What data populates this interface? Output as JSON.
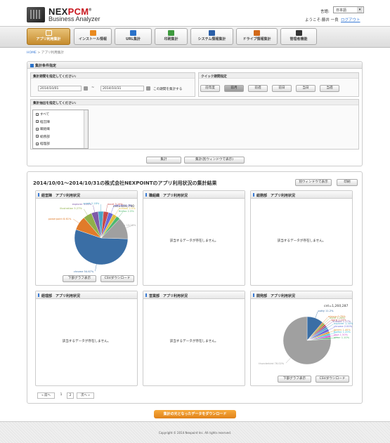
{
  "header": {
    "brand_a": "NEX",
    "brand_b": "PCM",
    "brand_reg": "®",
    "brand_sub": "Business Analyzer",
    "lang_label": "言語:",
    "lang_value": "日本語",
    "welcome": "ようこそ:藤井 一良",
    "logout": "ログアウト"
  },
  "nav": [
    {
      "label": "アプリ利用集計",
      "icon": "app-usage-icon",
      "color": "#ffffff",
      "active": true
    },
    {
      "label": "インストール情報",
      "icon": "install-list-icon",
      "color": "#e98a1f",
      "active": false
    },
    {
      "label": "URL集計",
      "icon": "url-link-icon",
      "color": "#2a72c9",
      "active": false
    },
    {
      "label": "印刷集計",
      "icon": "print-icon",
      "color": "#3e9a3e",
      "active": false
    },
    {
      "label": "システム情報集計",
      "icon": "system-edit-icon",
      "color": "#2a5fa8",
      "active": false
    },
    {
      "label": "ドライブ情報集計",
      "icon": "rss-drive-icon",
      "color": "#d26a1a",
      "active": false
    },
    {
      "label": "管理者機能",
      "icon": "gear-icon",
      "color": "#333333",
      "active": false
    }
  ],
  "breadcrumb": {
    "home": "HOME",
    "sep": ">",
    "current": "アプリ利用集計"
  },
  "conditions": {
    "title": "集計条件指定",
    "period_label": "集計期間を指定してください:",
    "date_from": "2014/10/01",
    "tilde": "~",
    "date_to": "2014/10/31",
    "period_note": "この期間を集計する",
    "quick_label": "クイック期間指定",
    "quick": [
      "前年度",
      "前月",
      "前週",
      "前日",
      "当日",
      "当週"
    ],
    "quick_selected": "前月",
    "target_label": "集計抽出を指定してください:",
    "targets": [
      {
        "label": "すべて",
        "checked": true
      },
      {
        "label": "経営陣",
        "checked": true
      },
      {
        "label": "職組織",
        "checked": true
      },
      {
        "label": "総務部",
        "checked": true
      },
      {
        "label": "経理部",
        "checked": true
      }
    ],
    "btn_run": "集計",
    "btn_run_new": "集計(別ウィンドウで表示)"
  },
  "results": {
    "title": "2014/10/01～2014/10/31の株式会社NEXPOINTのアプリ利用状況の集計結果",
    "btn_new_window": "別ウィンドウで表示",
    "btn_print": "印刷",
    "empty_msg": "該当するデータが存在しません。",
    "btn_sub_graph": "下部グラフ表示",
    "btn_csv": "CSVダウンロード",
    "cards": [
      {
        "title": "経営陣　アプリ利用状況",
        "total": "cnt=109,790",
        "has_data": true
      },
      {
        "title": "職組織　アプリ利用状況",
        "has_data": false
      },
      {
        "title": "総務部　アプリ利用状況",
        "has_data": false
      },
      {
        "title": "経理部　アプリ利用状況",
        "has_data": false
      },
      {
        "title": "営業部　アプリ利用状況",
        "has_data": false
      },
      {
        "title": "開発部　アプリ利用状況",
        "total": "cnt=1,260,287",
        "has_data": true
      }
    ],
    "pager": {
      "prev": "« 前へ",
      "p1": "1",
      "p2": "2",
      "next": "次へ »"
    }
  },
  "pie1": {
    "colors": [
      "#3a6ea5",
      "#e07b2a",
      "#8fb04a",
      "#7e5aa8",
      "#4aa6c8",
      "#c84a4a",
      "#6a6ad8",
      "#e0c040",
      "#50b870",
      "#a0a0a0"
    ],
    "values": [
      54.67,
      8.61,
      5.27,
      4.11,
      3.22,
      3.14,
      2.9,
      2.5,
      2.3,
      13.28
    ],
    "labels": [
      "chrome 54.67%",
      "powerpoint 8.61%",
      "illustration 5.27%",
      "explorer 3.22%",
      "acroit 2.18%",
      "excel 3.14%",
      "software 2.9%",
      "outlook 2.5%",
      "firefox 2.3%",
      "other 13.28%"
    ]
  },
  "pie2": {
    "colors": [
      "#3a6ea5",
      "#e07b2a",
      "#8fb04a",
      "#c84a4a",
      "#7e5aa8",
      "#4aa6c8",
      "#6a6ad8",
      "#e0a040",
      "#40c0d8",
      "#d060d0",
      "#50b870",
      "#a0a0a0"
    ],
    "values": [
      11.2,
      0.75,
      1.26,
      1.1,
      1.17,
      1.3,
      2.0,
      1.4,
      1.2,
      1.5,
      1.1,
      76.02
    ],
    "labels": [
      "putty 11.2%",
      "winscp 0.75%",
      "excel 1.26%",
      "word 1.10%",
      "outlook 1.17%",
      "explorer 1.30%",
      "chrome 2.00%",
      "teams 1.40%",
      "firefox 1.20%",
      "java 1.50%",
      "other 1.10%",
      "thunderbird 76.02%"
    ]
  },
  "footer": {
    "download": "集計の元となったデータをダウンロード",
    "copyright": "Copyright © 2014 Nexpoint Inc. All rights reserved."
  }
}
